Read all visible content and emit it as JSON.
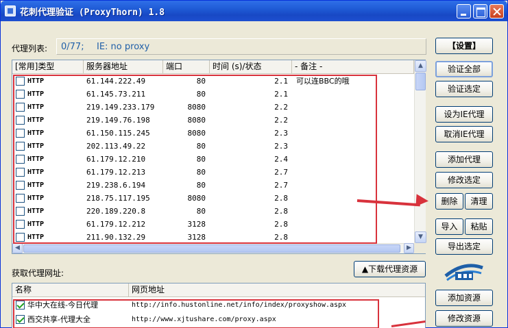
{
  "window": {
    "title": "花刺代理验证 (ProxyThorn) 1.8"
  },
  "status": {
    "label": "代理列表:",
    "count": "0/77;",
    "ie_status": "IE: no proxy"
  },
  "proxy_table": {
    "headers": [
      "[常用]类型",
      "服务器地址",
      "端口",
      "时间 (s)/状态",
      "- 备注 -"
    ],
    "rows": [
      {
        "type": "HTTP",
        "server": "61.144.222.49",
        "port": "80",
        "time": "2.1",
        "note": "可以连BBC的哦",
        "checked": false
      },
      {
        "type": "HTTP",
        "server": "61.145.73.211",
        "port": "80",
        "time": "2.1",
        "note": "",
        "checked": false
      },
      {
        "type": "HTTP",
        "server": "219.149.233.179",
        "port": "8080",
        "time": "2.2",
        "note": "",
        "checked": false
      },
      {
        "type": "HTTP",
        "server": "219.149.76.198",
        "port": "8080",
        "time": "2.2",
        "note": "",
        "checked": false
      },
      {
        "type": "HTTP",
        "server": "61.150.115.245",
        "port": "8080",
        "time": "2.3",
        "note": "",
        "checked": false
      },
      {
        "type": "HTTP",
        "server": "202.113.49.22",
        "port": "80",
        "time": "2.3",
        "note": "",
        "checked": false
      },
      {
        "type": "HTTP",
        "server": "61.179.12.210",
        "port": "80",
        "time": "2.4",
        "note": "",
        "checked": false
      },
      {
        "type": "HTTP",
        "server": "61.179.12.213",
        "port": "80",
        "time": "2.7",
        "note": "",
        "checked": false
      },
      {
        "type": "HTTP",
        "server": "219.238.6.194",
        "port": "80",
        "time": "2.7",
        "note": "",
        "checked": false
      },
      {
        "type": "HTTP",
        "server": "218.75.117.195",
        "port": "8080",
        "time": "2.8",
        "note": "",
        "checked": false
      },
      {
        "type": "HTTP",
        "server": "220.189.220.8",
        "port": "80",
        "time": "2.8",
        "note": "",
        "checked": false
      },
      {
        "type": "HTTP",
        "server": "61.179.12.212",
        "port": "3128",
        "time": "2.8",
        "note": "",
        "checked": false
      },
      {
        "type": "HTTP",
        "server": "211.90.132.29",
        "port": "3128",
        "time": "2.8",
        "note": "",
        "checked": false
      }
    ]
  },
  "buttons": {
    "settings": "【设置】",
    "verify_all": "验证全部",
    "verify_selected": "验证选定",
    "set_ie_proxy": "设为IE代理",
    "cancel_ie_proxy": "取消IE代理",
    "add_proxy": "添加代理",
    "edit_selected": "修改选定",
    "delete": "删除",
    "clean": "清理",
    "import": "导入",
    "paste": "粘贴",
    "export_selected": "导出选定",
    "download_resources": "▲下载代理资源",
    "add_resource": "添加资源",
    "edit_resource": "修改资源"
  },
  "resources": {
    "label": "获取代理网址:",
    "headers": [
      "名称",
      "网页地址"
    ],
    "rows": [
      {
        "name": "华中大在线-今日代理",
        "url": "http://info.hustonline.net/info/index/proxyshow.aspx",
        "checked": true
      },
      {
        "name": "西交共享-代理大全",
        "url": "http://www.xjtushare.com/proxy.aspx",
        "checked": true
      }
    ]
  },
  "colors": {
    "titlebar": "#1f5bd6",
    "status_text": "#1f5fa8",
    "annotation_red": "#d8323c"
  }
}
